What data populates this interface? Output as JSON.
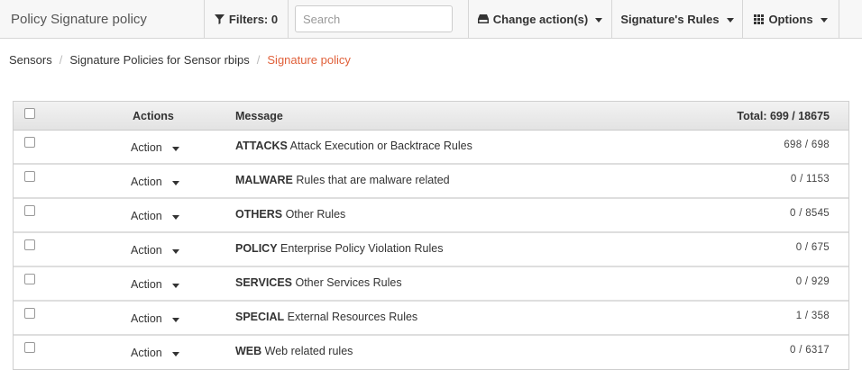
{
  "toolbar": {
    "title": "Policy Signature policy",
    "filters_label": "Filters: 0",
    "search_placeholder": "Search",
    "change_actions_label": "Change action(s)",
    "signature_rules_label": "Signature's Rules",
    "options_label": "Options"
  },
  "breadcrumb": {
    "items": [
      "Sensors",
      "Signature Policies for Sensor rbips"
    ],
    "active": "Signature policy"
  },
  "table": {
    "headers": {
      "actions": "Actions",
      "message": "Message",
      "total": "Total: 699 / 18675"
    },
    "rows": [
      {
        "action": "Action",
        "category": "ATTACKS",
        "description": "Attack Execution or Backtrace Rules",
        "count": "698 / 698"
      },
      {
        "action": "Action",
        "category": "MALWARE",
        "description": "Rules that are malware related",
        "count": "0 / 1153"
      },
      {
        "action": "Action",
        "category": "OTHERS",
        "description": "Other Rules",
        "count": "0 / 8545"
      },
      {
        "action": "Action",
        "category": "POLICY",
        "description": "Enterprise Policy Violation Rules",
        "count": "0 / 675"
      },
      {
        "action": "Action",
        "category": "SERVICES",
        "description": "Other Services Rules",
        "count": "0 / 929"
      },
      {
        "action": "Action",
        "category": "SPECIAL",
        "description": "External Resources Rules",
        "count": "1 / 358"
      },
      {
        "action": "Action",
        "category": "WEB",
        "description": "Web related rules",
        "count": "0 / 6317"
      }
    ]
  },
  "colors": {
    "breadcrumb_active": "#e0603a"
  },
  "icons": {
    "filter": "filter-icon",
    "change_actions": "hdd-icon",
    "options": "grid-icon"
  }
}
